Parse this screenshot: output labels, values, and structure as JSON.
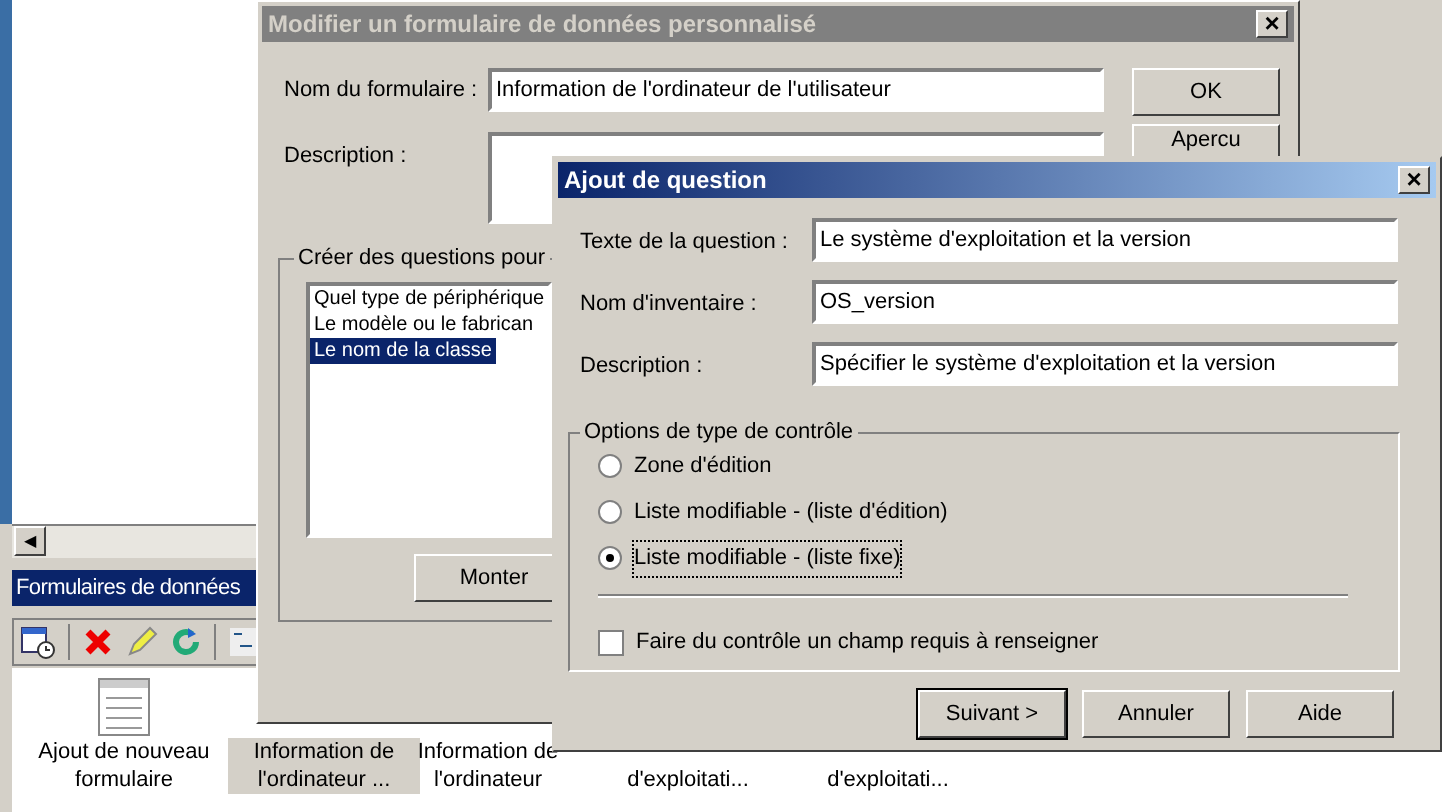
{
  "scroll_left": "◀",
  "back_panel": {
    "title": "Formulaires de données",
    "items": [
      {
        "label": "Ajout de nouveau formulaire",
        "kind": "new",
        "selected": false
      },
      {
        "label": "Information de l'ordinateur ...",
        "kind": "form",
        "selected": true
      },
      {
        "label": "Information de l'ordinateur",
        "kind": "form",
        "selected": false
      },
      {
        "label": "d'exploitati...",
        "kind": "hidden",
        "selected": false
      },
      {
        "label": "d'exploitati...",
        "kind": "hidden",
        "selected": false
      }
    ]
  },
  "edit_dialog": {
    "title": "Modifier un formulaire de données personnalisé",
    "close": "×",
    "form_name_label": "Nom du formulaire :",
    "form_name": "Information de l'ordinateur de l'utilisateur",
    "description_label": "Description :",
    "buttons": [
      "OK",
      "Apercu"
    ],
    "group_title": "Créer des questions pour",
    "questions": [
      {
        "label": "Quel type de périphérique",
        "selected": false
      },
      {
        "label": "Le modèle ou le fabrican",
        "selected": false
      },
      {
        "label": "Le nom de la classe",
        "selected": true
      }
    ],
    "move_button": "Monter"
  },
  "question_dialog": {
    "title": "Ajout de question",
    "close": "×",
    "fields": [
      {
        "label": "Texte de la question :",
        "value": "Le système d'exploitation et la version"
      },
      {
        "label": "Nom d'inventaire :",
        "value": "OS_version"
      },
      {
        "label": "Description :",
        "value": "Spécifier le système d'exploitation et la version"
      }
    ],
    "group_title": "Options de type de contrôle",
    "options": [
      {
        "label": "Zone d'édition",
        "selected": false
      },
      {
        "label": "Liste modifiable - (liste d'édition)",
        "selected": false
      },
      {
        "label": "Liste modifiable - (liste fixe)",
        "selected": true
      }
    ],
    "required": {
      "label": "Faire du contrôle un champ requis à renseigner",
      "checked": false
    },
    "buttons": [
      {
        "label": "Suivant >",
        "default": true
      },
      {
        "label": "Annuler",
        "default": false
      },
      {
        "label": "Aide",
        "default": false
      }
    ]
  }
}
